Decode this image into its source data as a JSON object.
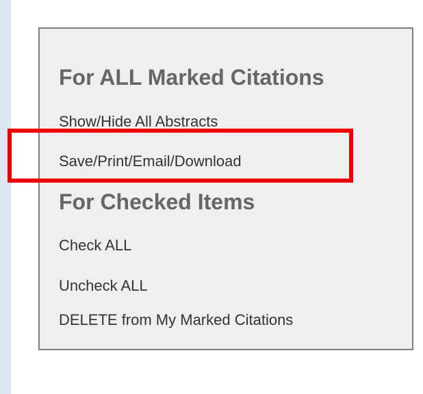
{
  "panel": {
    "marked_section": {
      "heading": "For ALL Marked Citations",
      "items": [
        {
          "label": "Show/Hide All Abstracts"
        },
        {
          "label": "Save/Print/Email/Download"
        }
      ]
    },
    "checked_section": {
      "heading": "For Checked Items",
      "items": [
        {
          "label": "Check ALL"
        },
        {
          "label": "Uncheck ALL"
        },
        {
          "label": "DELETE from My Marked Citations"
        }
      ]
    }
  },
  "colors": {
    "heading": "#666666",
    "link": "#333333",
    "panel_background": "#efefef",
    "panel_border": "#7f7f7f",
    "highlight": "#ee0000",
    "side_strip": "#dde6f1"
  }
}
